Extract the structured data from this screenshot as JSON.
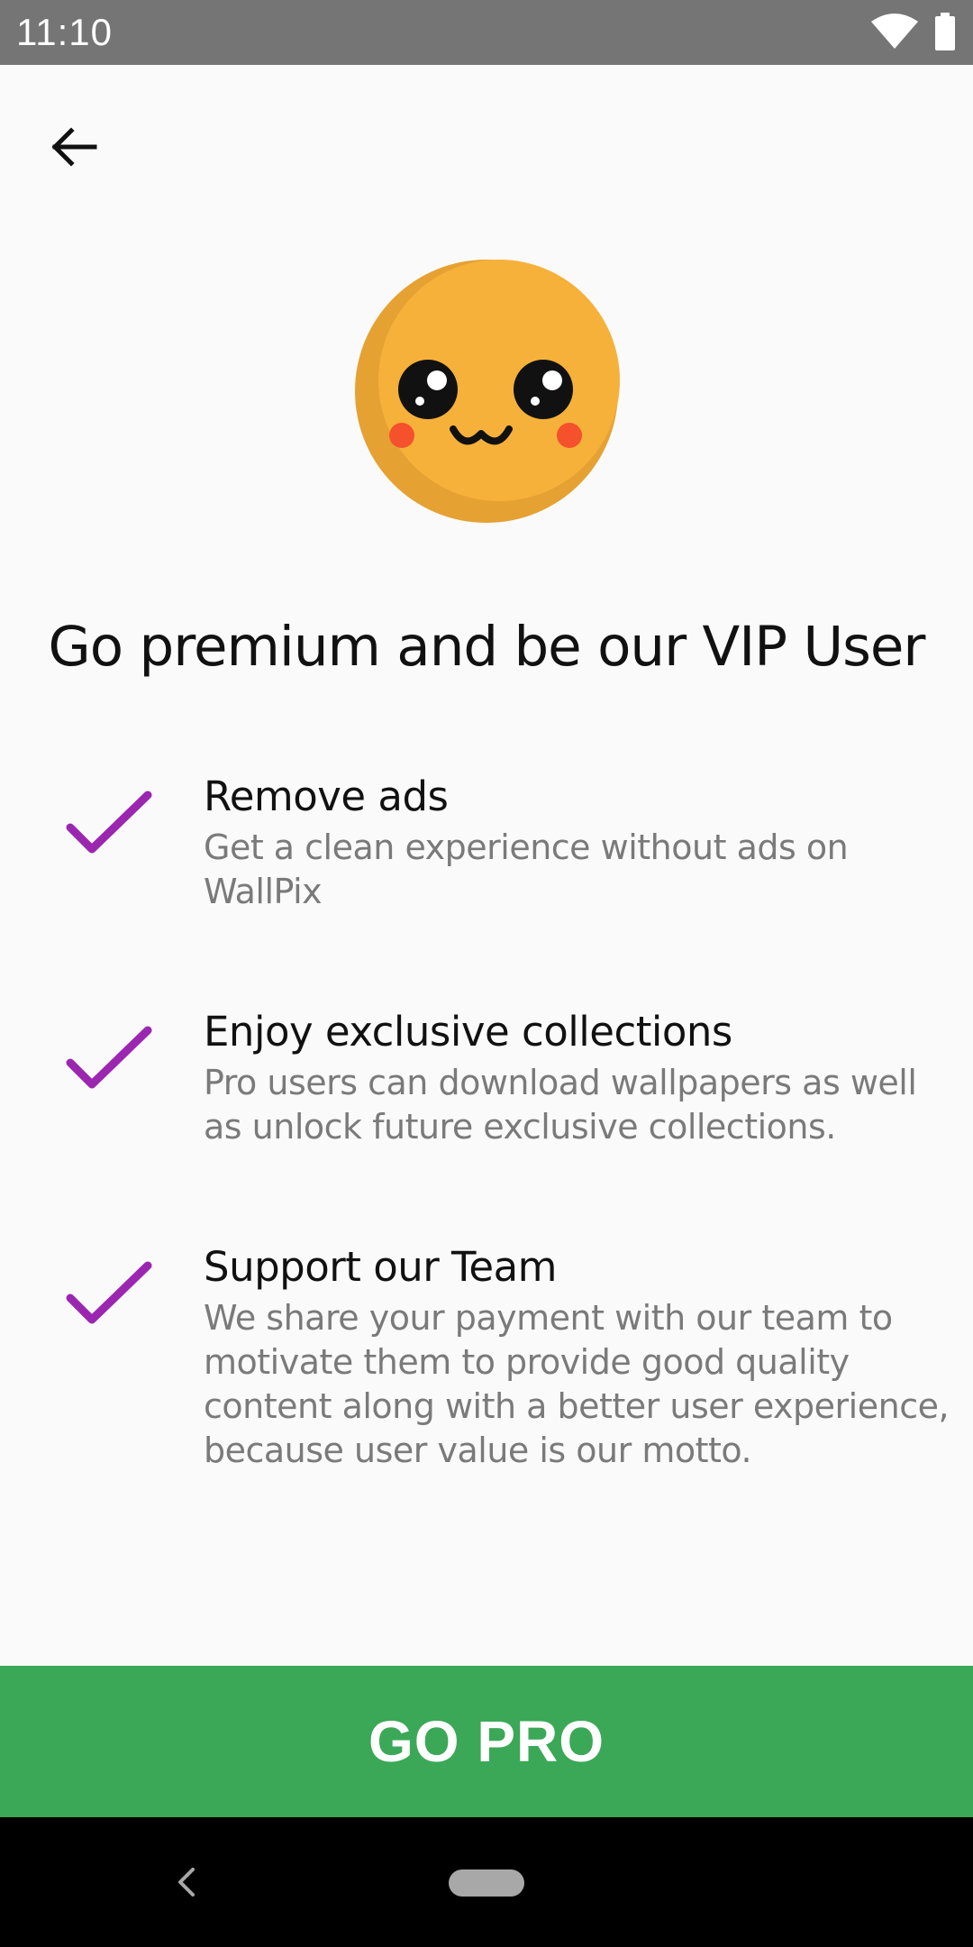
{
  "status_bar": {
    "time": "11:10",
    "icons": [
      "wifi-icon",
      "battery-icon"
    ]
  },
  "toolbar": {
    "back_icon": "arrow-left-icon"
  },
  "mascot": {
    "icon": "kawaii-face-emoji",
    "colors": {
      "face": "#f6b13a",
      "shadow": "#e5a132",
      "blush": "#f4512c",
      "eyes": "#111111"
    }
  },
  "headline": "Go premium and be our VIP User",
  "features": [
    {
      "title": "Remove ads",
      "description": "Get a clean experience without ads on WallPix"
    },
    {
      "title": "Enjoy exclusive collections",
      "description": "Pro users can download wallpapers as well as unlock future exclusive collections."
    },
    {
      "title": "Support our Team",
      "description": "We share your payment with our team to motivate them to provide good quality content along with a better user experience, because user value is our motto."
    }
  ],
  "check_icon": "check-icon",
  "check_color": "#9b27b0",
  "cta": {
    "label": "GO PRO",
    "color": "#3ba857"
  },
  "nav_bar": {
    "icons": [
      "nav-back-icon",
      "nav-home-pill"
    ]
  }
}
